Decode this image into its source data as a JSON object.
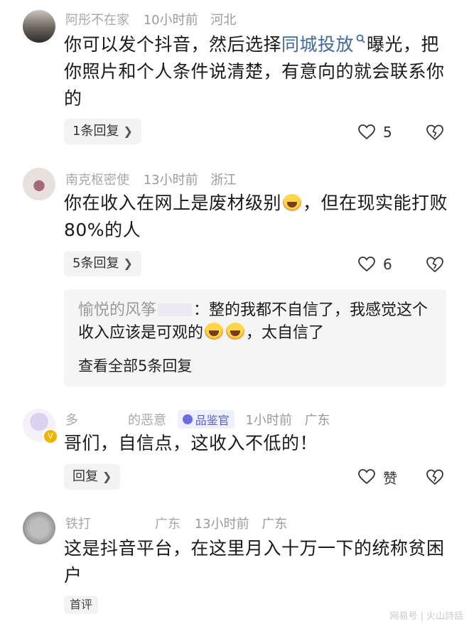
{
  "comments": [
    {
      "name": "阿彤不在家",
      "time": "10小时前",
      "location": "河北",
      "text_before": "你可以发个抖音，然后选择",
      "link": "同城投放",
      "text_after": "曝光，把你照片和个人条件说清楚，有意向的就会联系你的",
      "replies_label": "1条回复",
      "likes": "5"
    },
    {
      "name": "南克枢密使",
      "time": "13小时前",
      "location": "浙江",
      "text_before": "你在收入在网上是废材级别",
      "text_after": "，但在现实能打败80%的人",
      "replies_label": "5条回复",
      "likes": "6",
      "reply_preview": {
        "name": "愉悦的风筝",
        "text_line1": "：整的我都不自信了，我感觉这个",
        "text_line2_before": "收入应该是可观的",
        "text_line2_after": "，太自信了",
        "see_all": "查看全部5条回复"
      }
    },
    {
      "name": "多",
      "name_suffix": "的恶意",
      "badge": "品鉴官",
      "time": "1小时前",
      "location": "广东",
      "text": "哥们，自信点，这收入不低的！",
      "replies_label": "回复",
      "likes": "赞"
    },
    {
      "name": "铁打",
      "name_suffix": "广东",
      "time": "13小时前",
      "location": "广东",
      "text": "这是抖音平台，在这里月入十万一下的统称贫困户",
      "tag": "首评"
    }
  ],
  "watermark": "网易号 | 火山詩話"
}
